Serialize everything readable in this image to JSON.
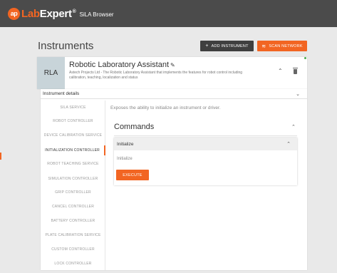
{
  "app": {
    "logo_mark": "ap",
    "logo_lab": "Lab",
    "logo_expert": "Expert",
    "logo_reg": "®",
    "subtitle": "SiLA Browser"
  },
  "page": {
    "title": "Instruments",
    "add_instrument_label": "ADD INSTRUMENT",
    "scan_network_label": "SCAN NETWORK"
  },
  "instrument": {
    "abbr": "RLA",
    "name": "Robotic Laboratory Assistant",
    "description": "Astech Projects Ltd - The Robotic Laboratory Assistant that implements the features for robot control including calibration, teaching, localization and status",
    "status_color": "#4caf50"
  },
  "details": {
    "header": "Instrument details",
    "nav_items": [
      {
        "label": "SILA SERVICE",
        "active": false
      },
      {
        "label": "ROBOT CONTROLLER",
        "active": false
      },
      {
        "label": "DEVICE CALIBRATION SERVICE",
        "active": false
      },
      {
        "label": "INITIALIZATION CONTROLLER",
        "active": true
      },
      {
        "label": "ROBOT TEACHING SERVICE",
        "active": false
      },
      {
        "label": "SIMULATION CONTROLLER",
        "active": false
      },
      {
        "label": "GRIP CONTROLLER",
        "active": false
      },
      {
        "label": "CANCEL CONTROLLER",
        "active": false
      },
      {
        "label": "BATTERY CONTROLLER",
        "active": false
      },
      {
        "label": "PLATE CALIBRATION SERVICE",
        "active": false
      },
      {
        "label": "CUSTOM CONTROLLER",
        "active": false
      },
      {
        "label": "LOCK CONTROLLER",
        "active": false
      }
    ],
    "feature_description": "Exposes the ability to initialize an instrument or driver.",
    "commands_title": "Commands",
    "command": {
      "name": "Initialize",
      "subtitle": "Initialize",
      "execute_label": "EXECUTE"
    }
  },
  "colors": {
    "accent": "#f26522",
    "appbar": "#4b4b4b",
    "dark_button": "#3f3f3f"
  }
}
